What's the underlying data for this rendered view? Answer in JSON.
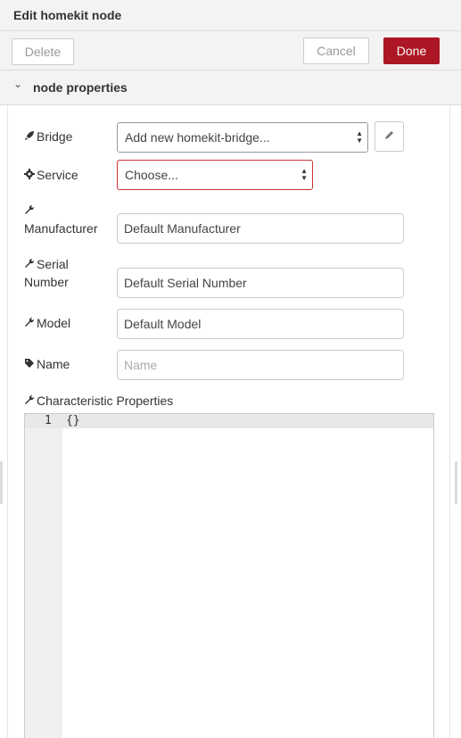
{
  "tray": {
    "title": "Edit homekit node"
  },
  "toolbar": {
    "delete_label": "Delete",
    "cancel_label": "Cancel",
    "done_label": "Done"
  },
  "colors": {
    "done_button": "#ad1625",
    "invalid_border": "#cc3333"
  },
  "section": {
    "title": "node properties",
    "icon": "chevron-down-icon"
  },
  "form": {
    "bridge": {
      "label": "Bridge",
      "icon": "rocket-icon",
      "value": "Add new homekit-bridge..."
    },
    "service": {
      "label": "Service",
      "icon": "gear-icon",
      "value": "Choose..."
    },
    "manufacturer": {
      "label": "Manufacturer",
      "icon": "wrench-icon",
      "value": "Default Manufacturer"
    },
    "serial": {
      "label_line1": "Serial",
      "label_line2": "Number",
      "icon": "wrench-icon",
      "value": "Default Serial Number"
    },
    "model": {
      "label": "Model",
      "icon": "wrench-icon",
      "value": "Default Model"
    },
    "name": {
      "label": "Name",
      "icon": "tag-icon",
      "value": "",
      "placeholder": "Name"
    },
    "characteristic": {
      "label": "Characteristic Properties",
      "icon": "wrench-icon"
    }
  },
  "editor": {
    "line_number": "1",
    "code": "{}"
  }
}
